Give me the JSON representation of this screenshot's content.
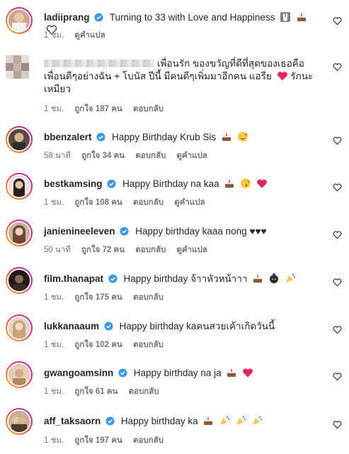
{
  "comments": [
    {
      "username": "ladiiprang",
      "text": "Turning to 33 with Love and Happiness",
      "time": "1 ชม.",
      "likes": "",
      "reply": "",
      "translate": "ดูคำแปล",
      "emojis": [
        "bunny-icon",
        "cake-icon",
        "white-heart-icon"
      ]
    },
    {
      "username": "",
      "text": "เพื่อนรัก ของขวัญที่ดีที่สุดของเธอคือ เพื่อนดีๆอย่างฉัน + โบนัส ปีนี้ มีคนดีๆเพิ่มมาอีกคน แอรีย",
      "text2": "รักนะ เหมียว",
      "time": "1 ชม.",
      "likes": "ถูกใจ 187 คน",
      "reply": "ตอบกลับ",
      "translate": "",
      "emojis": [
        "red-heart-icon"
      ]
    },
    {
      "username": "bbenzalert",
      "text": "Happy Birthday Krub Sis",
      "time": "58 นาที",
      "likes": "ถูกใจ 34 คน",
      "reply": "ตอบกลับ",
      "translate": "ดูคำแปล",
      "emojis": [
        "cake-icon",
        "smiling-face-hearts-icon"
      ]
    },
    {
      "username": "bestkamsing",
      "text": "Happy Birthday na kaa",
      "time": "1 ชม.",
      "likes": "ถูกใจ 108 คน",
      "reply": "ตอบกลับ",
      "translate": "ดูคำแปล",
      "emojis": [
        "cake-icon",
        "kiss-face-icon",
        "red-heart-icon"
      ]
    },
    {
      "username": "janienineeleven",
      "text": "Happy birthday kaaa nong ♥♥♥",
      "time": "50 นาที",
      "likes": "ถูกใจ 72 คน",
      "reply": "ตอบกลับ",
      "translate": "ดูคำแปล",
      "emojis": []
    },
    {
      "username": "film.thanapat",
      "text": "Happy birthday จ้าาหัวหน้าาา",
      "time": "1 ชม.",
      "likes": "ถูกใจ 175 คน",
      "reply": "ตอบกลับ",
      "translate": "",
      "emojis": [
        "cake-icon",
        "party-face-icon",
        "party-popper-icon"
      ]
    },
    {
      "username": "lukkanaaum",
      "text": "Happy birthday kaคนสวยเค้าเกิดวันนี้",
      "time": "1 ชม.",
      "likes": "ถูกใจ 102 คน",
      "reply": "ตอบกลับ",
      "translate": "",
      "emojis": []
    },
    {
      "username": "gwangoamsinn",
      "text": "Happy birthday na ja",
      "time": "1 ชม.",
      "likes": "ถูกใจ 61 คน",
      "reply": "ตอบกลับ",
      "translate": "",
      "emojis": [
        "cake-icon",
        "red-heart-icon"
      ]
    },
    {
      "username": "aff_taksaorn",
      "text": "Happy birthday ka",
      "time": "1 ชม.",
      "likes": "ถูกใจ 197 คน",
      "reply": "ตอบกลับ",
      "translate": "",
      "emojis": [
        "cake-icon",
        "party-popper-icon",
        "party-popper-icon",
        "party-popper-icon"
      ]
    }
  ],
  "colors": {
    "text": "#262626",
    "meta": "#737373",
    "verified": "#3897f0",
    "heart_red": "#e0245e",
    "cake": "#8b5a3c"
  }
}
